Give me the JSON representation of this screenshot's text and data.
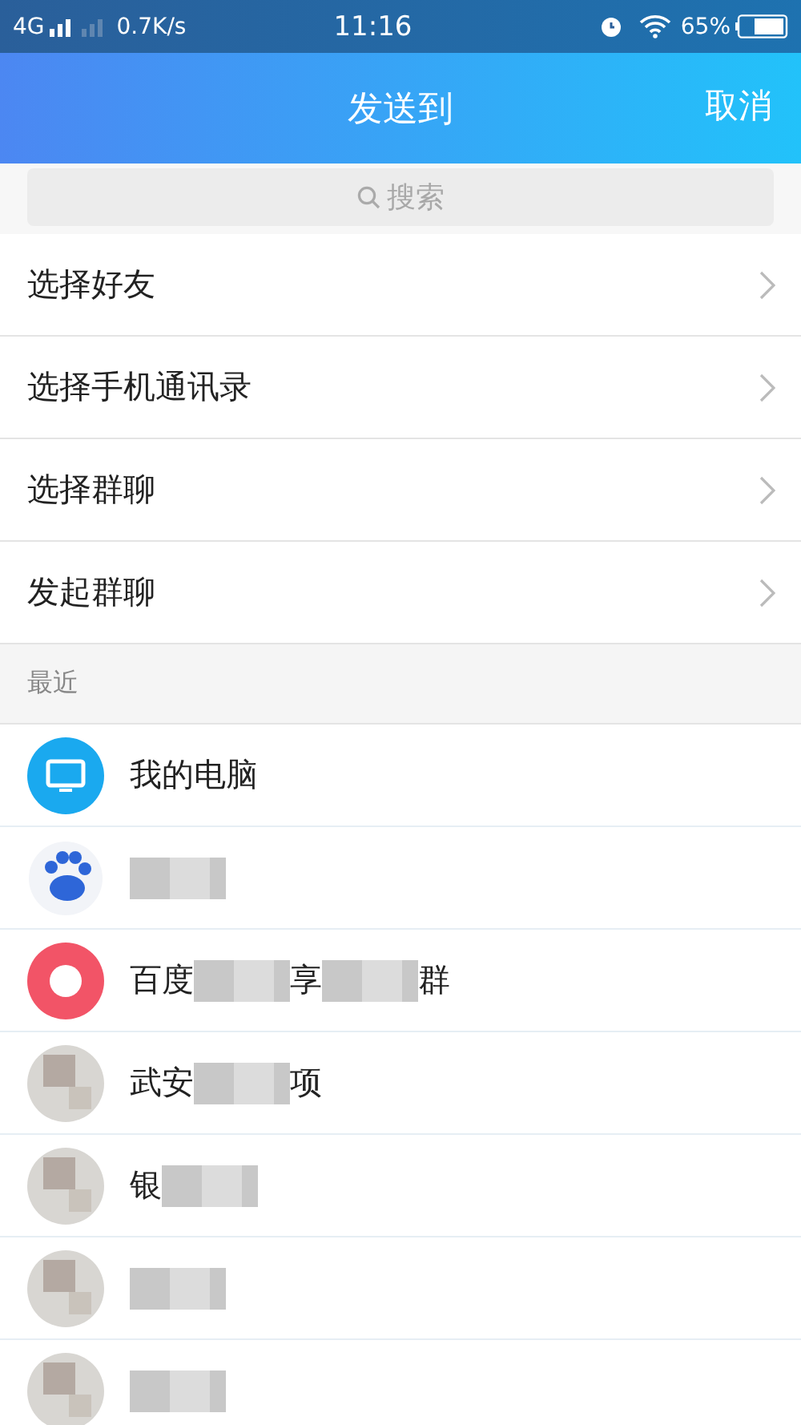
{
  "status_bar": {
    "network": "4G",
    "speed": "0.7K/s",
    "time": "11:16",
    "battery": "65%"
  },
  "header": {
    "title": "发送到",
    "action": "取消"
  },
  "search": {
    "placeholder": "搜索"
  },
  "menu": [
    {
      "label": "选择好友"
    },
    {
      "label": "选择手机通讯录"
    },
    {
      "label": "选择群聊"
    },
    {
      "label": "发起群聊"
    }
  ],
  "recent_heading": "最近",
  "recent": [
    {
      "kind": "computer",
      "name_parts": [
        "我的电脑"
      ],
      "redacted": false
    },
    {
      "kind": "paw",
      "redacted": true
    },
    {
      "kind": "ring",
      "name_parts": [
        "百度",
        "享",
        "群"
      ],
      "redacted": true
    },
    {
      "kind": "plain",
      "name_parts": [
        "武安",
        "项"
      ],
      "redacted": true
    },
    {
      "kind": "plain",
      "name_parts": [
        "银"
      ],
      "redacted": true
    },
    {
      "kind": "plain",
      "redacted": true
    },
    {
      "kind": "plain",
      "redacted": true
    }
  ]
}
